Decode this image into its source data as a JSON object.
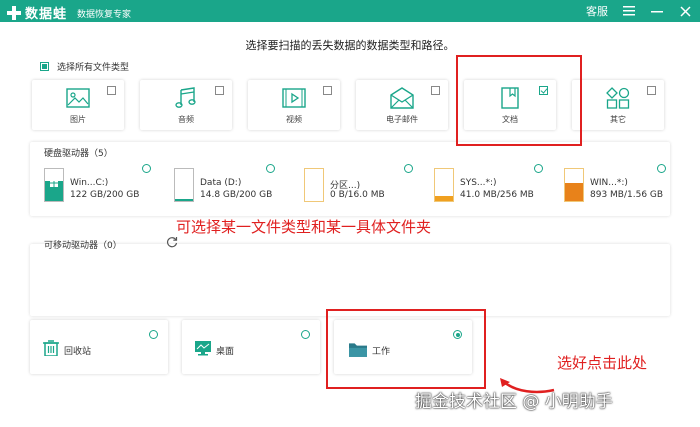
{
  "header": {
    "app_name": "数据蛙",
    "app_subtitle": "数据恢复专家",
    "service": "客服",
    "brand_color": "#1aa68a"
  },
  "subtitle": "选择要扫描的丢失数据的数据类型和路径。",
  "select_all": {
    "label": "选择所有文件类型",
    "checked": true
  },
  "file_types": [
    {
      "label": "图片",
      "icon": "image-icon",
      "checked": false
    },
    {
      "label": "音频",
      "icon": "music-icon",
      "checked": false
    },
    {
      "label": "视频",
      "icon": "video-icon",
      "checked": false
    },
    {
      "label": "电子邮件",
      "icon": "email-icon",
      "checked": false
    },
    {
      "label": "文档",
      "icon": "document-icon",
      "checked": true
    },
    {
      "label": "其它",
      "icon": "other-icon",
      "checked": false
    }
  ],
  "hard_drives": {
    "title": "硬盘驱动器（5）",
    "items": [
      {
        "name": "Win...C:)",
        "size": "122 GB/200 GB",
        "fill_fraction": 0.61,
        "fill_color": "#1aa68a"
      },
      {
        "name": "Data (D:)",
        "size": "14.8 GB/200 GB",
        "fill_fraction": 0.07,
        "fill_color": "#1aa68a"
      },
      {
        "name": "分区...)",
        "size": "0 B/16.0 MB",
        "fill_fraction": 0.0,
        "fill_color": "#f0a020"
      },
      {
        "name": "SYS...*:)",
        "size": "41.0 MB/256 MB",
        "fill_fraction": 0.16,
        "fill_color": "#f0a020"
      },
      {
        "name": "WIN...*:)",
        "size": "893 MB/1.56 GB",
        "fill_fraction": 0.56,
        "fill_color": "#e8821a"
      }
    ]
  },
  "removable": {
    "title": "可移动驱动器（0）"
  },
  "locations": [
    {
      "label": "回收站",
      "icon": "recycle-bin-icon",
      "selected": false
    },
    {
      "label": "桌面",
      "icon": "desktop-icon",
      "selected": false
    },
    {
      "label": "工作",
      "icon": "folder-icon",
      "selected": true
    }
  ],
  "annotations": {
    "main_note": "可选择某一文件类型和某一具体文件夹",
    "click_note": "选好点击此处",
    "annotation_color": "#e02020"
  },
  "watermark": "掘金技术社区 @ 小明助手"
}
